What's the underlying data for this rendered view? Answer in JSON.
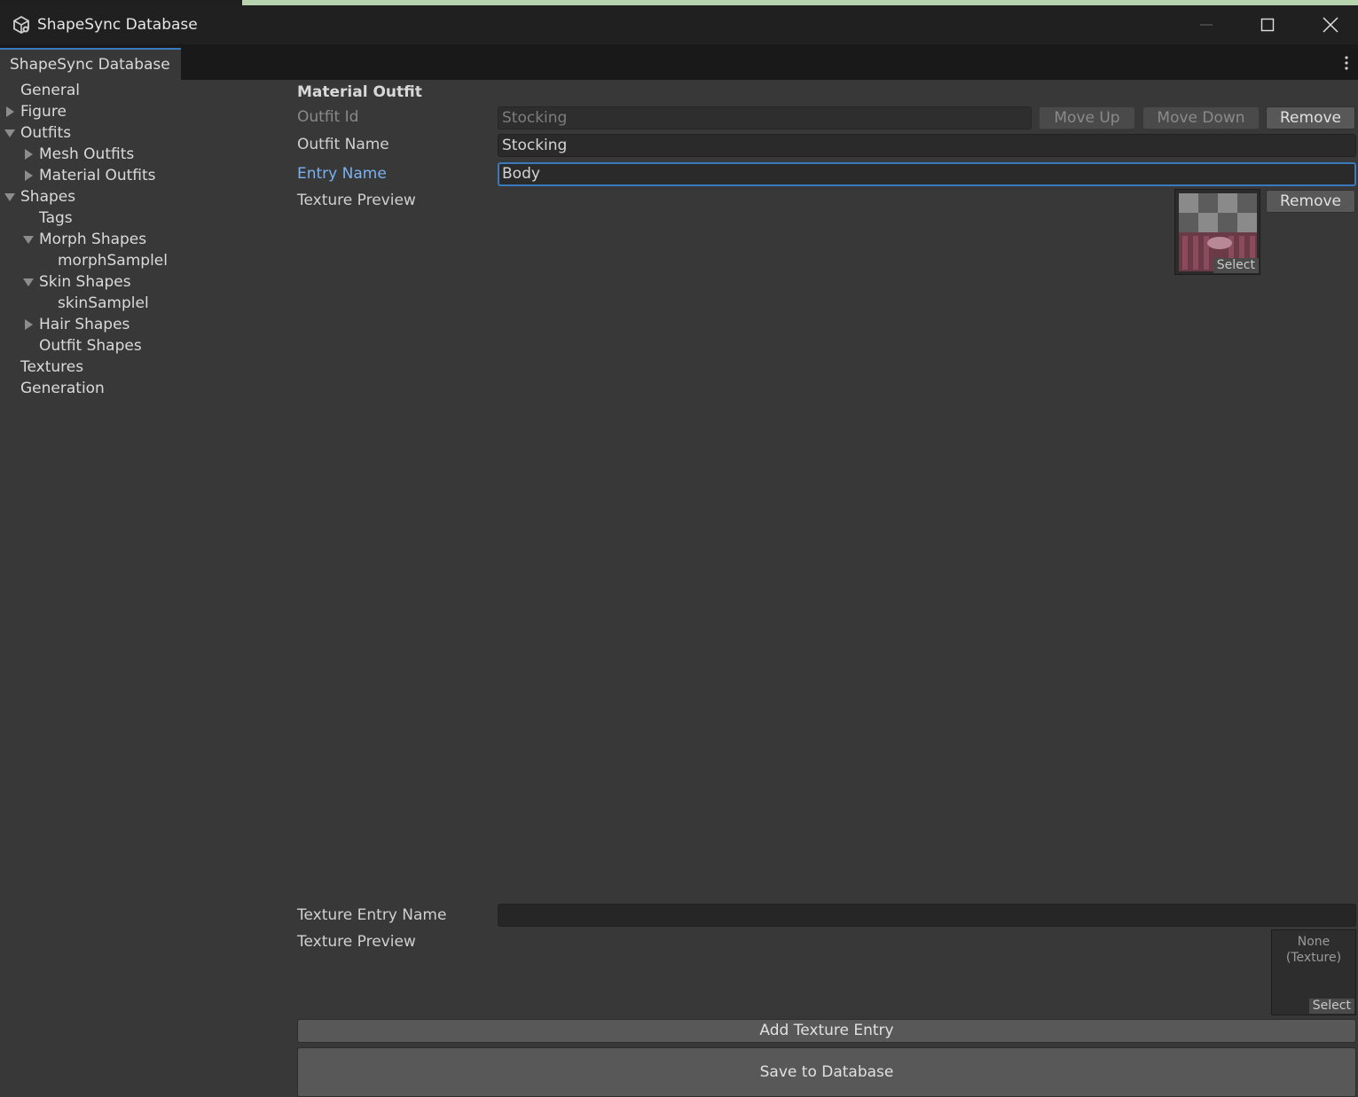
{
  "window": {
    "title": "ShapeSync Database",
    "icon": "unity-cube-icon",
    "controls": [
      "minimize-icon",
      "maximize-icon",
      "close-icon"
    ]
  },
  "tab": {
    "label": "ShapeSync Database"
  },
  "tree": {
    "items": [
      {
        "label": "General",
        "expander": "none"
      },
      {
        "label": "Figure",
        "expander": "collapsed"
      },
      {
        "label": "Outfits",
        "expander": "expanded"
      },
      {
        "label": "Mesh Outfits",
        "expander": "collapsed"
      },
      {
        "label": "Material Outfits",
        "expander": "collapsed"
      },
      {
        "label": "Shapes",
        "expander": "expanded"
      },
      {
        "label": "Tags",
        "expander": "none"
      },
      {
        "label": "Morph Shapes",
        "expander": "expanded"
      },
      {
        "label": "morphSamplel",
        "expander": "none"
      },
      {
        "label": "Skin Shapes",
        "expander": "expanded"
      },
      {
        "label": "skinSamplel",
        "expander": "none"
      },
      {
        "label": "Hair Shapes",
        "expander": "collapsed"
      },
      {
        "label": "Outfit Shapes",
        "expander": "none"
      },
      {
        "label": "Textures",
        "expander": "none"
      },
      {
        "label": "Generation",
        "expander": "none"
      }
    ]
  },
  "form": {
    "section_title": "Material Outfit",
    "outfit_id": {
      "label": "Outfit Id",
      "value": "Stocking"
    },
    "move_up": "Move Up",
    "move_down": "Move Down",
    "remove": "Remove",
    "outfit_name": {
      "label": "Outfit Name",
      "value": "Stocking"
    },
    "entry": {
      "label": "Entry Name",
      "value": "Body",
      "preview_label": "Texture Preview",
      "select": "Select",
      "remove": "Remove"
    },
    "new_entry": {
      "name_label": "Texture Entry Name",
      "name_value": "",
      "preview_label": "Texture Preview",
      "none_line1": "None",
      "none_line2": "(Texture)",
      "select": "Select"
    },
    "add_texture_entry": "Add Texture Entry",
    "save": "Save to Database"
  }
}
